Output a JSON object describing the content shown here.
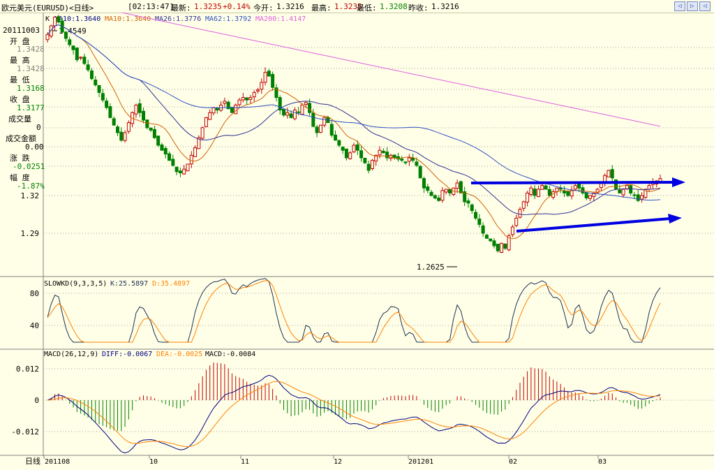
{
  "header": {
    "symbol": "欧元美元(EURUSD)<日线>",
    "time": "[02:13:47]",
    "latest_label": "最新:",
    "latest": "1.3235",
    "change": "+0.14%",
    "open_label": "今开:",
    "open": "1.3216",
    "high_label": "最高:",
    "high": "1.3235",
    "low_label": "最低:",
    "low": "1.3208",
    "prev_label": "昨收:",
    "prev": "1.3216",
    "nav_prev": "◁",
    "nav_next": "▷",
    "nav_close": "◁"
  },
  "ma_legend": {
    "k": "K",
    "ma10a": "MA10:1.3640",
    "ma10b": "MA10:1.3640",
    "ma26": "MA26:1.3776",
    "ma62": "MA62:1.3792",
    "ma200": "MA200:1.4147"
  },
  "info_panel": {
    "date": "20111003",
    "open_label": "开 盘",
    "open": "1.3428",
    "high_label": "最 高",
    "high": "1.3428",
    "low_label": "最 低",
    "low": "1.3168",
    "close_label": "收 盘",
    "close": "1.3177",
    "volume_label": "成交量",
    "volume": "0",
    "amount_label": "成交金额",
    "amount": "0.00",
    "change_label": "涨 跌",
    "change": "-0.0251",
    "range_label": "幅 度",
    "range": "-1.87%"
  },
  "kd_legend": {
    "name": "SLOWKD(9,3,3,5)",
    "k": "K:25.5897",
    "d": "D:35.4897"
  },
  "macd_legend": {
    "name": "MACD(26,12,9)",
    "diff": "DIFF:-0.0067",
    "dea": "DEA:-0.0025",
    "macd": "MACD:-0.0084"
  },
  "x_axis_label": "日线",
  "colors": {
    "up": "#c00000",
    "down": "#008000",
    "ma10": "#d06000",
    "ma26": "#303090",
    "ma62": "#3050c0",
    "ma200": "#e060e0",
    "kd_k": "#203050",
    "kd_d": "#ff8000",
    "arrow": "#0000e0"
  },
  "chart_data": [
    {
      "type": "candlestick",
      "title": "欧元美元(EURUSD)<日线>",
      "y_ticks": [
        "1.32",
        "1.29"
      ],
      "x_ticks": [
        "201108",
        "10",
        "11",
        "12",
        "201201",
        "02",
        "03"
      ],
      "annotations": [
        "1.4549",
        "1.2625"
      ],
      "series": [
        {
          "name": "MA10",
          "current": 1.364
        },
        {
          "name": "MA26",
          "current": 1.3776
        },
        {
          "name": "MA62",
          "current": 1.3792
        },
        {
          "name": "MA200",
          "current": 1.4147
        }
      ],
      "close": [
        1.438,
        1.445,
        1.452,
        1.448,
        1.44,
        1.435,
        1.43,
        1.426,
        1.418,
        1.42,
        1.415,
        1.41,
        1.403,
        1.398,
        1.392,
        1.386,
        1.38,
        1.372,
        1.366,
        1.36,
        1.354,
        1.36,
        1.368,
        1.376,
        1.382,
        1.376,
        1.37,
        1.364,
        1.362,
        1.356,
        1.35,
        1.346,
        1.343,
        1.338,
        1.334,
        1.329,
        1.328,
        1.331,
        1.335,
        1.342,
        1.348,
        1.356,
        1.364,
        1.372,
        1.376,
        1.38,
        1.378,
        1.382,
        1.385,
        1.379,
        1.376,
        1.382,
        1.386,
        1.388,
        1.386,
        1.388,
        1.392,
        1.394,
        1.4,
        1.408,
        1.405,
        1.396,
        1.388,
        1.378,
        1.374,
        1.376,
        1.372,
        1.378,
        1.376,
        1.382,
        1.384,
        1.376,
        1.365,
        1.36,
        1.366,
        1.372,
        1.368,
        1.358,
        1.354,
        1.35,
        1.346,
        1.34,
        1.344,
        1.35,
        1.346,
        1.34,
        1.336,
        1.33,
        1.338,
        1.342,
        1.346,
        1.344,
        1.34,
        1.342,
        1.34,
        1.339,
        1.338,
        1.336,
        1.34,
        1.338,
        1.334,
        1.324,
        1.316,
        1.314,
        1.31,
        1.308,
        1.306,
        1.314,
        1.315,
        1.312,
        1.316,
        1.32,
        1.312,
        1.305,
        1.304,
        1.298,
        1.292,
        1.287,
        1.28,
        1.276,
        1.274,
        1.27,
        1.266,
        1.272,
        1.268,
        1.278,
        1.285,
        1.292,
        1.299,
        1.305,
        1.312,
        1.316,
        1.31,
        1.315,
        1.318,
        1.315,
        1.31,
        1.313,
        1.316,
        1.315,
        1.312,
        1.31,
        1.314,
        1.318,
        1.316,
        1.312,
        1.308,
        1.31,
        1.312,
        1.315,
        1.32,
        1.326,
        1.33,
        1.324,
        1.315,
        1.312,
        1.315,
        1.318,
        1.312,
        1.31,
        1.306,
        1.31,
        1.315,
        1.318,
        1.32,
        1.3216,
        1.3235
      ]
    },
    {
      "type": "line",
      "title": "SLOWKD(9,3,3,5)",
      "y_ticks": [
        "80",
        "40"
      ],
      "series": [
        {
          "name": "K",
          "current": 25.5897
        },
        {
          "name": "D",
          "current": 35.4897
        }
      ]
    },
    {
      "type": "bar",
      "title": "MACD(26,12,9)",
      "y_ticks": [
        "0.012",
        "0",
        "-0.012"
      ],
      "series": [
        {
          "name": "DIFF",
          "current": -0.0067
        },
        {
          "name": "DEA",
          "current": -0.0025
        },
        {
          "name": "MACD",
          "current": -0.0084
        }
      ]
    }
  ]
}
